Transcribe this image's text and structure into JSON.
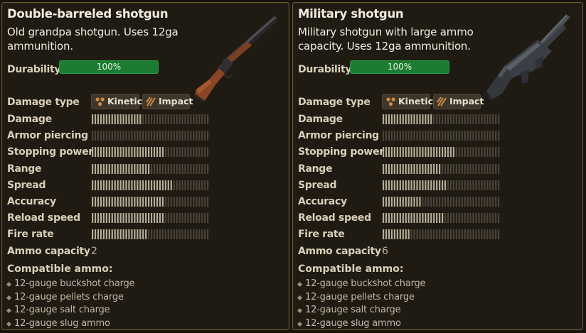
{
  "cards": [
    {
      "title": "Double-barreled shotgun",
      "description": "Old grandpa shotgun. Uses 12ga ammunition.",
      "durability_label": "Durability",
      "durability_value": "100%",
      "durability_fraction": 1.0,
      "damage_type_label": "Damage type",
      "damage_types": [
        "Kinetic",
        "Impact"
      ],
      "stats": [
        {
          "label": "Damage",
          "fill": 0.44
        },
        {
          "label": "Armor piercing",
          "fill": 0.0
        },
        {
          "label": "Stopping power",
          "fill": 0.61
        },
        {
          "label": "Range",
          "fill": 0.5
        },
        {
          "label": "Spread",
          "fill": 0.68
        },
        {
          "label": "Accuracy",
          "fill": 0.61
        },
        {
          "label": "Reload speed",
          "fill": 0.62
        },
        {
          "label": "Fire rate",
          "fill": 0.48
        }
      ],
      "ammo_capacity_label": "Ammo capacity",
      "ammo_capacity": "2",
      "compatible_ammo_label": "Compatible ammo:",
      "compatible_ammo": [
        "12-gauge buckshot charge",
        "12-gauge pellets charge",
        "12-gauge salt charge",
        "12-gauge slug ammo"
      ],
      "gun_icon": "double-barreled-shotgun"
    },
    {
      "title": "Military shotgun",
      "description": "Military shotgun with large ammo capacity. Uses 12ga ammunition.",
      "durability_label": "Durability",
      "durability_value": "100%",
      "durability_fraction": 1.0,
      "damage_type_label": "Damage type",
      "damage_types": [
        "Kinetic",
        "Impact"
      ],
      "stats": [
        {
          "label": "Damage",
          "fill": 0.42
        },
        {
          "label": "Armor piercing",
          "fill": 0.0
        },
        {
          "label": "Stopping power",
          "fill": 0.61
        },
        {
          "label": "Range",
          "fill": 0.5
        },
        {
          "label": "Spread",
          "fill": 0.55
        },
        {
          "label": "Accuracy",
          "fill": 0.33
        },
        {
          "label": "Reload speed",
          "fill": 0.52
        },
        {
          "label": "Fire rate",
          "fill": 0.23
        }
      ],
      "ammo_capacity_label": "Ammo capacity",
      "ammo_capacity": "6",
      "compatible_ammo_label": "Compatible ammo:",
      "compatible_ammo": [
        "12-gauge buckshot charge",
        "12-gauge pellets charge",
        "12-gauge salt charge",
        "12-gauge slug ammo"
      ],
      "gun_icon": "military-shotgun"
    }
  ],
  "colors": {
    "bar_filled": "#b7ae98",
    "bar_empty": "#4a443a",
    "durability_green": "#1c7c32"
  }
}
